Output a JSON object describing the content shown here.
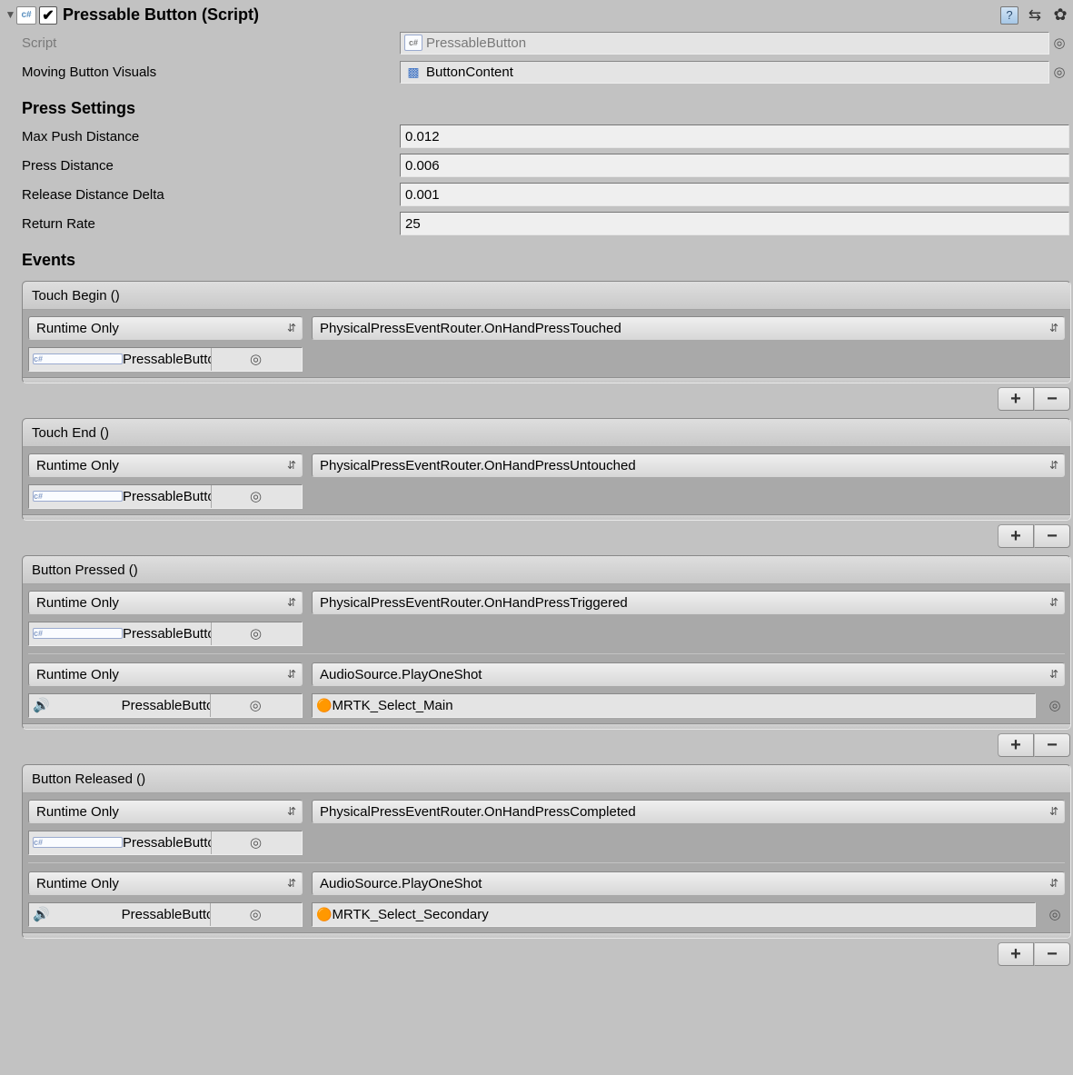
{
  "header": {
    "title": "Pressable Button (Script)",
    "enabled_checkmark": "✔"
  },
  "fields": {
    "script": {
      "label": "Script",
      "value": "PressableButton"
    },
    "movingButtonVisuals": {
      "label": "Moving Button Visuals",
      "value": "ButtonContent"
    }
  },
  "sections": {
    "press": "Press Settings",
    "events": "Events"
  },
  "press": {
    "maxPushDistance": {
      "label": "Max Push Distance",
      "value": "0.012"
    },
    "pressDistance": {
      "label": "Press Distance",
      "value": "0.006"
    },
    "releaseDistanceDelta": {
      "label": "Release Distance Delta",
      "value": "0.001"
    },
    "returnRate": {
      "label": "Return Rate",
      "value": "25"
    }
  },
  "events": [
    {
      "name": "Touch Begin ()",
      "entries": [
        {
          "callState": "Runtime Only",
          "target": "PressableButtonPlated (P",
          "targetIcon": "cs",
          "function": "PhysicalPressEventRouter.OnHandPressTouched",
          "arg": null,
          "argIcon": null
        }
      ]
    },
    {
      "name": "Touch End ()",
      "entries": [
        {
          "callState": "Runtime Only",
          "target": "PressableButtonPlated (P",
          "targetIcon": "cs",
          "function": "PhysicalPressEventRouter.OnHandPressUntouched",
          "arg": null,
          "argIcon": null
        }
      ]
    },
    {
      "name": "Button Pressed ()",
      "entries": [
        {
          "callState": "Runtime Only",
          "target": "PressableButtonPlated (P",
          "targetIcon": "cs",
          "function": "PhysicalPressEventRouter.OnHandPressTriggered",
          "arg": null,
          "argIcon": null
        },
        {
          "callState": "Runtime Only",
          "target": "PressableButtonPlated (A",
          "targetIcon": "audio",
          "function": "AudioSource.PlayOneShot",
          "arg": "MRTK_Select_Main",
          "argIcon": "clip"
        }
      ]
    },
    {
      "name": "Button Released ()",
      "entries": [
        {
          "callState": "Runtime Only",
          "target": "PressableButtonPlated (P",
          "targetIcon": "cs",
          "function": "PhysicalPressEventRouter.OnHandPressCompleted",
          "arg": null,
          "argIcon": null
        },
        {
          "callState": "Runtime Only",
          "target": "PressableButtonPlated (A",
          "targetIcon": "audio",
          "function": "AudioSource.PlayOneShot",
          "arg": "MRTK_Select_Secondary",
          "argIcon": "clip"
        }
      ]
    }
  ],
  "buttons": {
    "add": "+",
    "remove": "−"
  }
}
